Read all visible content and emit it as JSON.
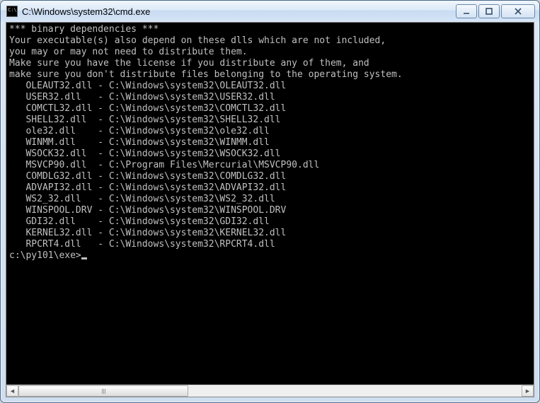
{
  "window": {
    "title": "C:\\Windows\\system32\\cmd.exe"
  },
  "console": {
    "header": "*** binary dependencies ***",
    "line1": "Your executable(s) also depend on these dlls which are not included,",
    "line2": "you may or may not need to distribute them.",
    "line3": "Make sure you have the license if you distribute any of them, and",
    "line4": "make sure you don't distribute files belonging to the operating system.",
    "deps": [
      {
        "name": "OLEAUT32.dll",
        "path": "C:\\Windows\\system32\\OLEAUT32.dll"
      },
      {
        "name": "USER32.dll",
        "path": "C:\\Windows\\system32\\USER32.dll"
      },
      {
        "name": "COMCTL32.dll",
        "path": "C:\\Windows\\system32\\COMCTL32.dll"
      },
      {
        "name": "SHELL32.dll",
        "path": "C:\\Windows\\system32\\SHELL32.dll"
      },
      {
        "name": "ole32.dll",
        "path": "C:\\Windows\\system32\\ole32.dll"
      },
      {
        "name": "WINMM.dll",
        "path": "C:\\Windows\\system32\\WINMM.dll"
      },
      {
        "name": "WSOCK32.dll",
        "path": "C:\\Windows\\system32\\WSOCK32.dll"
      },
      {
        "name": "MSVCP90.dll",
        "path": "C:\\Program Files\\Mercurial\\MSVCP90.dll"
      },
      {
        "name": "COMDLG32.dll",
        "path": "C:\\Windows\\system32\\COMDLG32.dll"
      },
      {
        "name": "ADVAPI32.dll",
        "path": "C:\\Windows\\system32\\ADVAPI32.dll"
      },
      {
        "name": "WS2_32.dll",
        "path": "C:\\Windows\\system32\\WS2_32.dll"
      },
      {
        "name": "WINSPOOL.DRV",
        "path": "C:\\Windows\\system32\\WINSPOOL.DRV"
      },
      {
        "name": "GDI32.dll",
        "path": "C:\\Windows\\system32\\GDI32.dll"
      },
      {
        "name": "KERNEL32.dll",
        "path": "C:\\Windows\\system32\\KERNEL32.dll"
      },
      {
        "name": "RPCRT4.dll",
        "path": "C:\\Windows\\system32\\RPCRT4.dll"
      }
    ],
    "prompt": "c:\\py101\\exe>"
  }
}
